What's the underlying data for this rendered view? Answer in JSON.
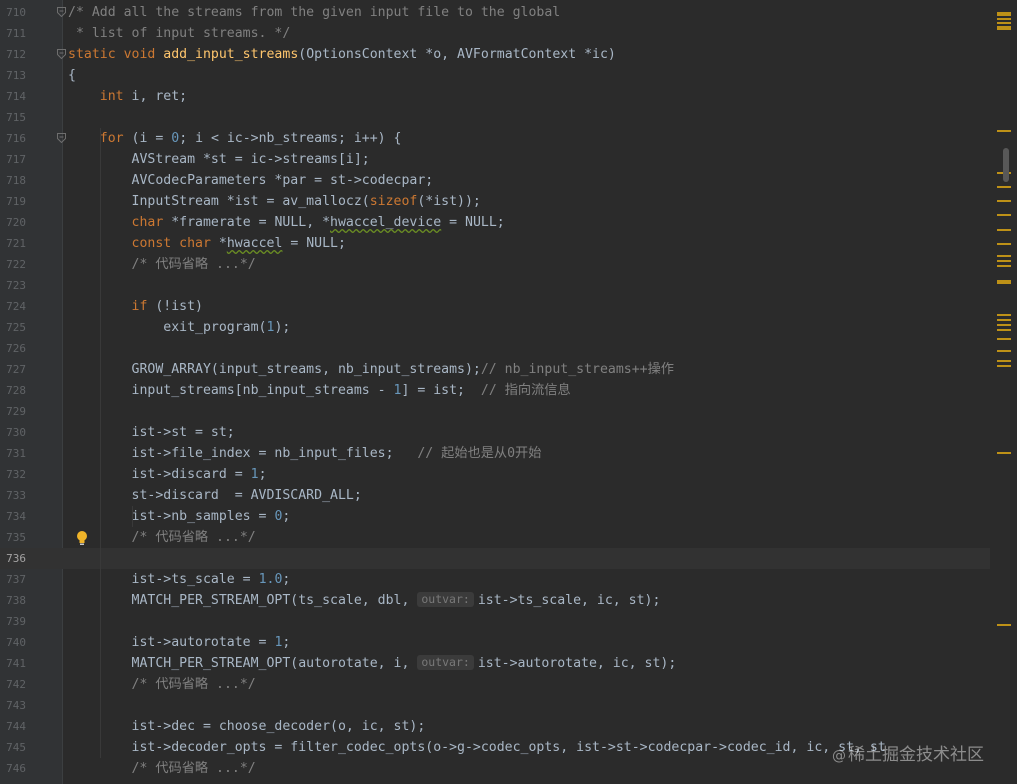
{
  "editor": {
    "current_line": "736",
    "lines": [
      {
        "n": "710",
        "fold": true,
        "tokens": [
          {
            "t": "/* Add all the streams from the given input file to the global",
            "c": "cmt"
          }
        ]
      },
      {
        "n": "711",
        "tokens": [
          {
            "t": " * list of input streams. */",
            "c": "cmt"
          }
        ]
      },
      {
        "n": "712",
        "fold": true,
        "tokens": [
          {
            "t": "static void ",
            "c": "kw"
          },
          {
            "t": "add_input_streams",
            "c": "fn"
          },
          {
            "t": "(OptionsContext *o, AVFormatContext *ic)"
          }
        ]
      },
      {
        "n": "713",
        "tokens": [
          {
            "t": "{"
          }
        ]
      },
      {
        "n": "714",
        "tokens": [
          {
            "t": "    "
          },
          {
            "t": "int ",
            "c": "kw"
          },
          {
            "t": "i, ret;"
          }
        ]
      },
      {
        "n": "715",
        "tokens": []
      },
      {
        "n": "716",
        "fold": true,
        "tokens": [
          {
            "t": "    "
          },
          {
            "t": "for ",
            "c": "kw"
          },
          {
            "t": "(i = "
          },
          {
            "t": "0",
            "c": "num"
          },
          {
            "t": "; i < ic->nb_streams; i++) {"
          }
        ]
      },
      {
        "n": "717",
        "tokens": [
          {
            "t": "        AVStream *st = ic->streams[i];"
          }
        ]
      },
      {
        "n": "718",
        "tokens": [
          {
            "t": "        AVCodecParameters *par = st->codecpar;"
          }
        ]
      },
      {
        "n": "719",
        "tokens": [
          {
            "t": "        InputStream *ist = av_mallocz("
          },
          {
            "t": "sizeof",
            "c": "kw"
          },
          {
            "t": "(*ist));"
          }
        ]
      },
      {
        "n": "720",
        "tokens": [
          {
            "t": "        "
          },
          {
            "t": "char ",
            "c": "kw"
          },
          {
            "t": "*framerate = NULL, *"
          },
          {
            "t": "hwaccel_device",
            "c": "ul"
          },
          {
            "t": " = NULL;"
          }
        ]
      },
      {
        "n": "721",
        "tokens": [
          {
            "t": "        "
          },
          {
            "t": "const char ",
            "c": "kw"
          },
          {
            "t": "*"
          },
          {
            "t": "hwaccel",
            "c": "ul"
          },
          {
            "t": " = NULL;"
          }
        ]
      },
      {
        "n": "722",
        "tokens": [
          {
            "t": "        /* 代码省略 ...*/",
            "c": "cmt"
          }
        ]
      },
      {
        "n": "723",
        "tokens": []
      },
      {
        "n": "724",
        "tokens": [
          {
            "t": "        "
          },
          {
            "t": "if ",
            "c": "kw"
          },
          {
            "t": "(!ist)"
          }
        ]
      },
      {
        "n": "725",
        "tokens": [
          {
            "t": "            exit_program("
          },
          {
            "t": "1",
            "c": "num"
          },
          {
            "t": ");"
          }
        ]
      },
      {
        "n": "726",
        "tokens": []
      },
      {
        "n": "727",
        "tokens": [
          {
            "t": "        GROW_ARRAY(input_streams, nb_input_streams);"
          },
          {
            "t": "// nb_input_streams++操作",
            "c": "cmt"
          }
        ]
      },
      {
        "n": "728",
        "tokens": [
          {
            "t": "        input_streams[nb_input_streams - "
          },
          {
            "t": "1",
            "c": "num"
          },
          {
            "t": "] = ist;  "
          },
          {
            "t": "// 指向流信息",
            "c": "cmt"
          }
        ]
      },
      {
        "n": "729",
        "tokens": []
      },
      {
        "n": "730",
        "tokens": [
          {
            "t": "        ist->st = st;"
          }
        ]
      },
      {
        "n": "731",
        "tokens": [
          {
            "t": "        ist->file_index = nb_input_files;   "
          },
          {
            "t": "// 起始也是从0开始",
            "c": "cmt"
          }
        ]
      },
      {
        "n": "732",
        "tokens": [
          {
            "t": "        ist->discard = "
          },
          {
            "t": "1",
            "c": "num"
          },
          {
            "t": ";"
          }
        ]
      },
      {
        "n": "733",
        "tokens": [
          {
            "t": "        st->discard  = AVDISCARD_ALL;"
          }
        ]
      },
      {
        "n": "734",
        "tokens": [
          {
            "t": "        ist->nb_samples = "
          },
          {
            "t": "0",
            "c": "num"
          },
          {
            "t": ";"
          }
        ]
      },
      {
        "n": "735",
        "bulb": true,
        "tokens": [
          {
            "t": "        /* 代码省略 ...*/",
            "c": "cmt"
          }
        ]
      },
      {
        "n": "736",
        "tokens": []
      },
      {
        "n": "737",
        "tokens": [
          {
            "t": "        ist->ts_scale = "
          },
          {
            "t": "1.0",
            "c": "num"
          },
          {
            "t": ";"
          }
        ]
      },
      {
        "n": "738",
        "tokens": [
          {
            "t": "        MATCH_PER_STREAM_OPT(ts_scale, dbl, "
          },
          {
            "t": "outvar:",
            "c": "hint"
          },
          {
            "t": "ist->ts_scale, ic, st);"
          }
        ]
      },
      {
        "n": "739",
        "tokens": []
      },
      {
        "n": "740",
        "tokens": [
          {
            "t": "        ist->autorotate = "
          },
          {
            "t": "1",
            "c": "num"
          },
          {
            "t": ";"
          }
        ]
      },
      {
        "n": "741",
        "tokens": [
          {
            "t": "        MATCH_PER_STREAM_OPT(autorotate, i, "
          },
          {
            "t": "outvar:",
            "c": "hint"
          },
          {
            "t": "ist->autorotate, ic, st);"
          }
        ]
      },
      {
        "n": "742",
        "tokens": [
          {
            "t": "        /* 代码省略 ...*/",
            "c": "cmt"
          }
        ]
      },
      {
        "n": "743",
        "tokens": []
      },
      {
        "n": "744",
        "tokens": [
          {
            "t": "        ist->dec = choose_decoder(o, ic, st);"
          }
        ]
      },
      {
        "n": "745",
        "tokens": [
          {
            "t": "        ist->decoder_opts = filter_codec_opts(o->g->codec_opts, ist->st->codecpar->codec_id, ic, st, st"
          }
        ]
      },
      {
        "n": "746",
        "tokens": [
          {
            "t": "        /* 代码省略 ...*/",
            "c": "cmt"
          }
        ]
      }
    ]
  },
  "colors": {
    "background": "#2b2b2b",
    "gutter": "#313335",
    "keyword": "#cc7832",
    "function": "#ffc66d",
    "number": "#6897bb",
    "comment": "#808080",
    "text": "#a9b7c6",
    "marker": "#be9117"
  },
  "icons": {
    "fold": "fold-arrow-icon",
    "bulb": "lightbulb-icon",
    "analysis": "analysis-status-icon"
  },
  "watermark": {
    "at": "@",
    "text": "稀土掘金技术社区"
  }
}
